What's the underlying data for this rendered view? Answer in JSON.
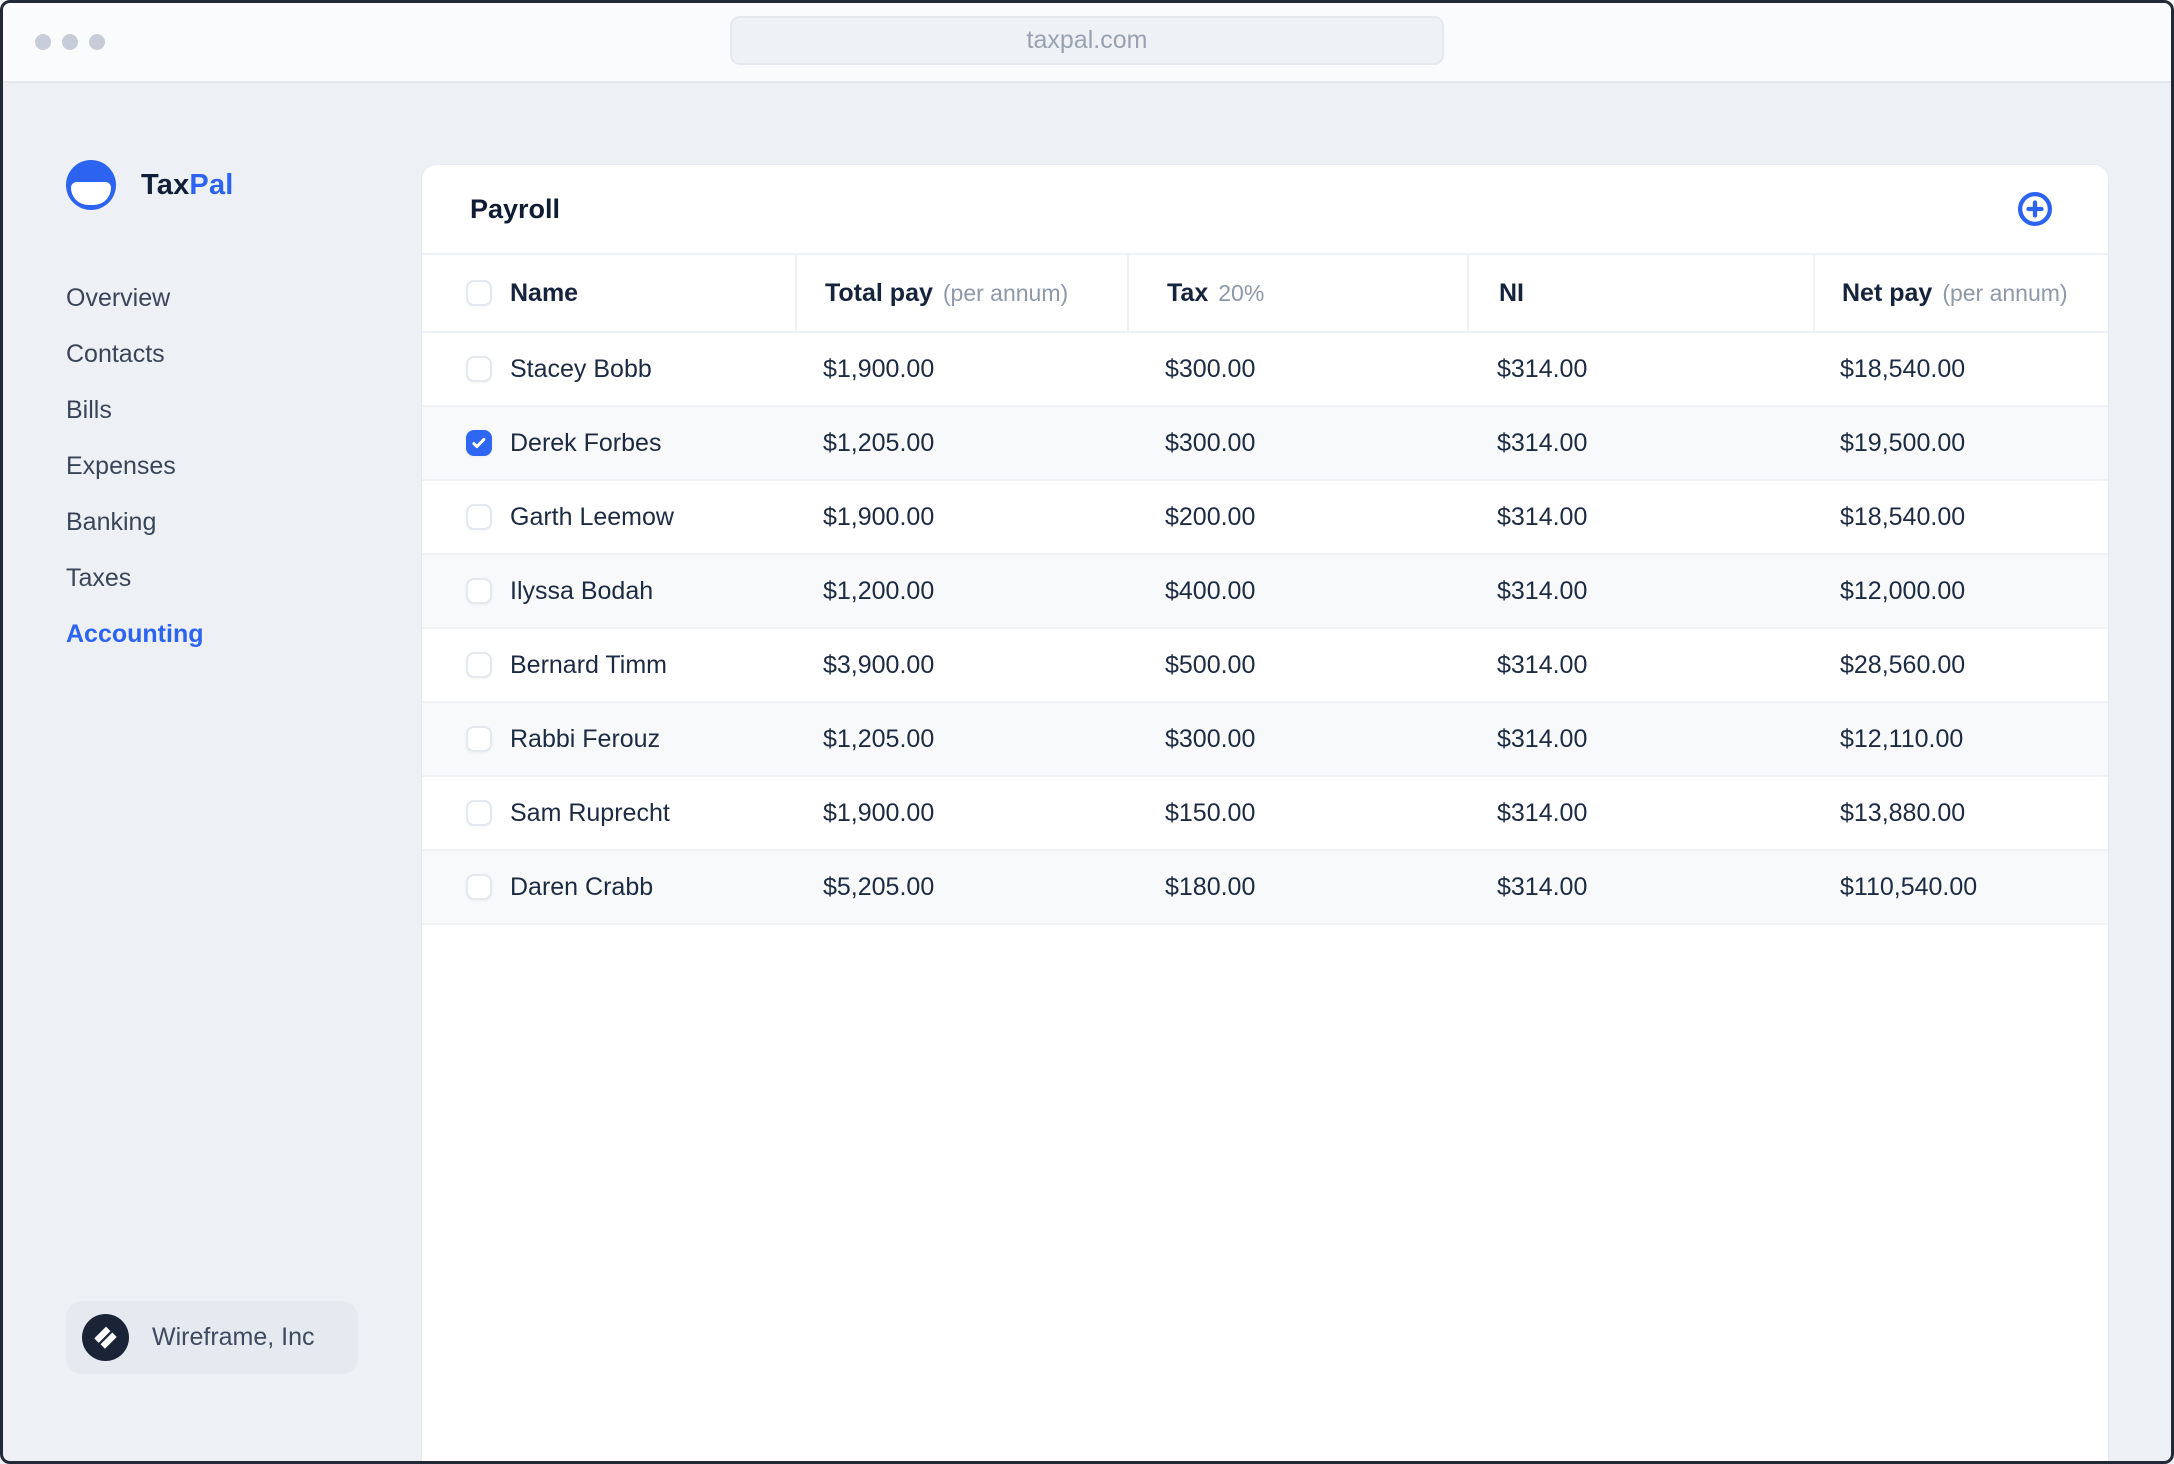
{
  "window": {
    "url": "taxpal.com"
  },
  "brand": {
    "logo_icon": "taxpal-smile-circle-icon",
    "name_prefix": "Tax",
    "name_suffix": "Pal"
  },
  "sidebar": {
    "items": [
      {
        "label": "Overview",
        "active": false
      },
      {
        "label": "Contacts",
        "active": false
      },
      {
        "label": "Bills",
        "active": false
      },
      {
        "label": "Expenses",
        "active": false
      },
      {
        "label": "Banking",
        "active": false
      },
      {
        "label": "Taxes",
        "active": false
      },
      {
        "label": "Accounting",
        "active": true
      }
    ],
    "company": {
      "label": "Wireframe, Inc",
      "logo_icon": "double-slash-circle-icon"
    }
  },
  "payroll": {
    "title": "Payroll",
    "add_button_icon": "circle-plus-icon",
    "columns": [
      {
        "label": "Name",
        "sub": ""
      },
      {
        "label": "Total pay",
        "sub": "(per annum)"
      },
      {
        "label": "Tax",
        "sub": "20%"
      },
      {
        "label": "NI",
        "sub": ""
      },
      {
        "label": "Net pay",
        "sub": "(per annum)"
      }
    ],
    "rows": [
      {
        "name": "Stacey Bobb",
        "checked": false,
        "total_pay": "$1,900.00",
        "tax": "$300.00",
        "ni": "$314.00",
        "net_pay": "$18,540.00"
      },
      {
        "name": "Derek Forbes",
        "checked": true,
        "total_pay": "$1,205.00",
        "tax": "$300.00",
        "ni": "$314.00",
        "net_pay": "$19,500.00"
      },
      {
        "name": "Garth Leemow",
        "checked": false,
        "total_pay": "$1,900.00",
        "tax": "$200.00",
        "ni": "$314.00",
        "net_pay": "$18,540.00"
      },
      {
        "name": "Ilyssa Bodah",
        "checked": false,
        "total_pay": "$1,200.00",
        "tax": "$400.00",
        "ni": "$314.00",
        "net_pay": "$12,000.00"
      },
      {
        "name": "Bernard Timm",
        "checked": false,
        "total_pay": "$3,900.00",
        "tax": "$500.00",
        "ni": "$314.00",
        "net_pay": "$28,560.00"
      },
      {
        "name": "Rabbi Ferouz",
        "checked": false,
        "total_pay": "$1,205.00",
        "tax": "$300.00",
        "ni": "$314.00",
        "net_pay": "$12,110.00"
      },
      {
        "name": "Sam Ruprecht",
        "checked": false,
        "total_pay": "$1,900.00",
        "tax": "$150.00",
        "ni": "$314.00",
        "net_pay": "$13,880.00"
      },
      {
        "name": "Daren Crabb",
        "checked": false,
        "total_pay": "$5,205.00",
        "tax": "$180.00",
        "ni": "$314.00",
        "net_pay": "$110,540.00"
      }
    ]
  },
  "colors": {
    "accent_blue": "#2c63f1",
    "dark_text": "#14213a",
    "muted_text": "#8d98a9",
    "page_bg": "#edf1f6",
    "stripe_bg": "#f7f9fb",
    "frame_border": "#222a38"
  }
}
